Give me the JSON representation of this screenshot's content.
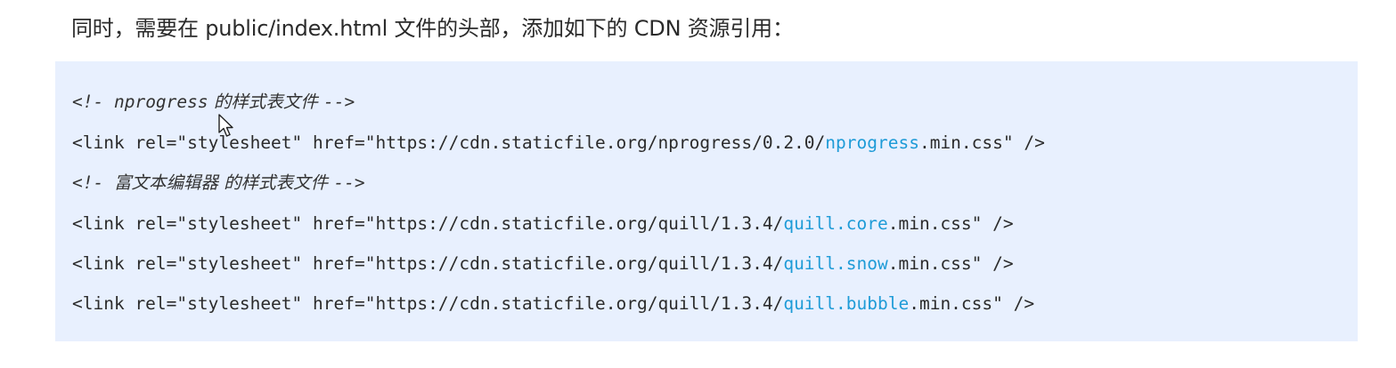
{
  "intro_text": "同时，需要在 public/index.html 文件的头部，添加如下的 CDN 资源引用：",
  "code": {
    "line1": {
      "open": "<!- ",
      "name": "nprogress",
      "cn": " 的样式表文件 ",
      "close": "-->"
    },
    "line2": {
      "prefix": "<link rel=\"stylesheet\" href=\"https://cdn.staticfile.org/nprogress/0.2.0/",
      "highlight": "nprogress",
      "suffix": ".min.css\" />"
    },
    "line3": {
      "open": "<!- ",
      "cn": "富文本编辑器 的样式表文件 ",
      "close": "-->"
    },
    "line4": {
      "prefix": "<link rel=\"stylesheet\" href=\"https://cdn.staticfile.org/quill/1.3.4/",
      "highlight": "quill.core",
      "suffix": ".min.css\" />"
    },
    "line5": {
      "prefix": "<link rel=\"stylesheet\" href=\"https://cdn.staticfile.org/quill/1.3.4/",
      "highlight": "quill.snow",
      "suffix": ".min.css\" />"
    },
    "line6": {
      "prefix": "<link rel=\"stylesheet\" href=\"https://cdn.staticfile.org/quill/1.3.4/",
      "highlight": "quill.bubble",
      "suffix": ".min.css\" />"
    }
  },
  "colors": {
    "code_background": "#e8f0fe",
    "highlight": "#1e9bd7",
    "text": "#2b2b2b"
  },
  "icons": {
    "cursor": "mouse-pointer-icon"
  }
}
